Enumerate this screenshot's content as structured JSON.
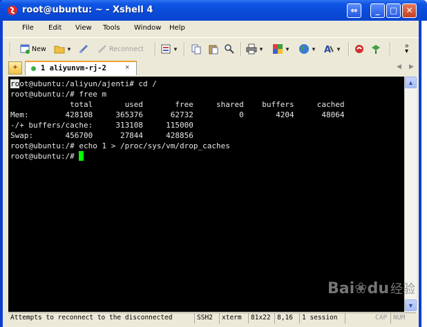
{
  "window": {
    "title": "root@ubuntu: ~ - Xshell 4"
  },
  "menu": [
    "File",
    "Edit",
    "View",
    "Tools",
    "Window",
    "Help"
  ],
  "toolbar": {
    "new_label": "New",
    "reconnect_label": "Reconnect"
  },
  "tabs": [
    {
      "label": "1 aliyunvm-rj-2",
      "close": "×"
    }
  ],
  "terminal": {
    "lines": [
      "root@ubuntu:/aliyun/ajenti# cd /",
      "root@ubuntu:/# free m",
      "             total       used       free     shared    buffers     cached",
      "Mem:        428108     365376      62732          0       4204      48064",
      "-/+ buffers/cache:     313108     115000",
      "Swap:       456700      27844     428856",
      "root@ubuntu:/# echo 1 > /proc/sys/vm/drop_caches",
      "root@ubuntu:/# "
    ]
  },
  "status": {
    "message": "Attempts to reconnect to the disconnected",
    "protocol": "SSH2",
    "term": "xterm",
    "size": "81x22",
    "cursor": "8,16",
    "sessions": "1 session",
    "caps": "CAP",
    "num": "NUM"
  },
  "watermark": {
    "brand": "Bai",
    "brand2": "du",
    "sub": "经验"
  },
  "colors": {
    "title_blue": "#0a4ad8",
    "terminal_bg": "#000000",
    "cursor": "#00ff00",
    "tab_indicator": "#3cb043"
  }
}
